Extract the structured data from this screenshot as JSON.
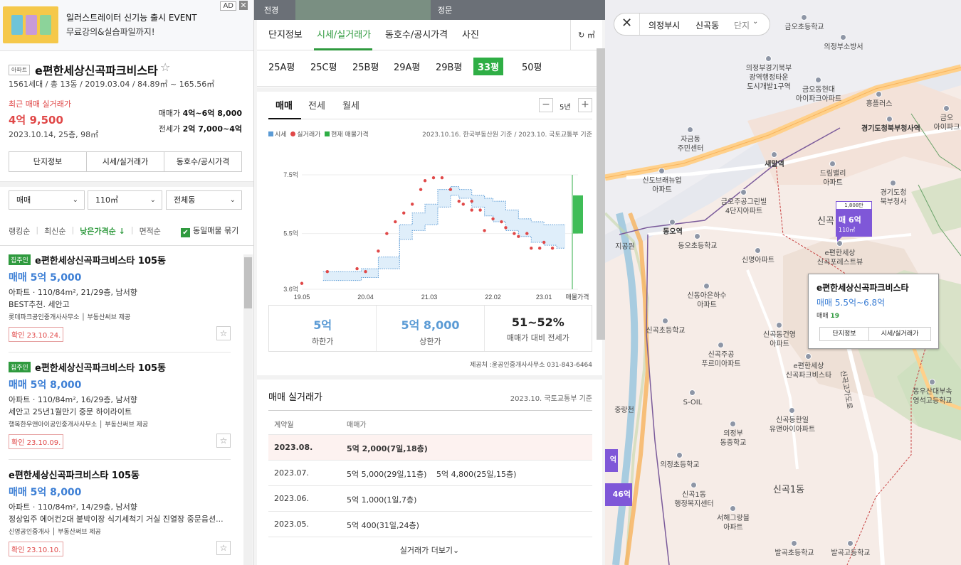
{
  "ad": {
    "title": "일러스트레이터 신기능 출시 EVENT",
    "sub": "무료강의&실습파일까지!",
    "tag": "AD",
    "close": "✕"
  },
  "complex": {
    "type_tag": "아파트",
    "name": "e편한세상신곡파크비스타",
    "star": "☆",
    "meta": "1561세대 / 총 13동 / 2019.03.04 / 84.89㎡ ~ 165.56㎡",
    "recent_label": "최근 매매 실거래가",
    "recent_price": "4억 9,500",
    "recent_detail": "2023.10.14, 25층, 98㎡",
    "sale_label": "매매가",
    "sale_range": "4억~6억 8,000",
    "jeonse_label": "전세가",
    "jeonse_range": "2억 7,000~4억",
    "buttons": [
      "단지정보",
      "시세/실거래가",
      "동호수/공시가격"
    ]
  },
  "filters": {
    "type": "매매",
    "area": "110㎡",
    "dong": "전체동",
    "caret": "⌄"
  },
  "sorts": {
    "items": [
      "랭킹순",
      "최신순",
      "낮은가격순 ↓",
      "면적순"
    ],
    "bar": "|",
    "check_label": "동일매물 묶기",
    "check_mark": "✔"
  },
  "listings": [
    {
      "badge": "집주인",
      "name": "e편한세상신곡파크비스타 105동",
      "price": "매매 5억 5,000",
      "spec": "아파트 · 110/84m², 21/29층, 남서향",
      "desc": "BEST추천. 세안고",
      "agent": "롯데파크공인중개사사무소 │ 부동산써브 제공",
      "confirm": "확인 23.10.24.",
      "fav": "☆"
    },
    {
      "badge": "집주인",
      "name": "e편한세상신곡파크비스타 105동",
      "price": "매매 5억 8,000",
      "spec": "아파트 · 110/84m², 16/29층, 남서향",
      "desc": "세안고 25년1월만기 중문 하이라이트",
      "agent": "행복한우앤아이공인중개사사무소 │ 부동산써브 제공",
      "confirm": "확인 23.10.09.",
      "fav": "☆"
    },
    {
      "badge": "",
      "name": "e편한세상신곡파크비스타 105동",
      "price": "매매 5억 8,000",
      "spec": "아파트 · 110/84m², 14/29층, 남서향",
      "desc": "정상입주 에어컨2대 붙박이장 식기세척기 거실 진열장 중문음션...",
      "agent": "신영공인중개사 │ 부동산써브 제공",
      "confirm": "확인 23.10.10.",
      "fav": "☆"
    }
  ],
  "street": {
    "left": "전경",
    "right": "정문"
  },
  "main_tabs": {
    "items": [
      "단지정보",
      "시세/실거래가",
      "동호수/공시가격",
      "사진"
    ],
    "unit": "↻ ㎡"
  },
  "pyeong_tabs": [
    "25A평",
    "25C평",
    "25B평",
    "29A평",
    "29B평",
    "33평",
    "50평"
  ],
  "deal_tabs": [
    "매매",
    "전세",
    "월세"
  ],
  "period": {
    "minus": "−",
    "plus": "+",
    "value": "5년"
  },
  "legend": {
    "items": [
      "시세",
      "실거래가",
      "현재 매물가격"
    ],
    "colors": [
      "#5b9bd5",
      "#e04848",
      "#2fae45"
    ],
    "source": "2023.10.16. 한국부동산원 기준 / 2023.10. 국토교통부 기준"
  },
  "chart_data": {
    "type": "line",
    "x_ticks": [
      "19.05",
      "20.04",
      "21.03",
      "22.02",
      "23.01",
      "매물가격"
    ],
    "y_ticks": [
      "7.5억",
      "5.5억",
      "3.6억"
    ],
    "ylim": [
      3.6,
      7.5
    ],
    "band_time": [
      0,
      4,
      6,
      9,
      13,
      18,
      21,
      24,
      27,
      30,
      32,
      35,
      38,
      40,
      43,
      46,
      49,
      52,
      55,
      57
    ],
    "band_upper": [
      4.2,
      4.2,
      4.2,
      4.3,
      4.7,
      5.8,
      6.2,
      6.5,
      7.0,
      7.1,
      7.0,
      6.8,
      6.7,
      6.6,
      6.3,
      6.0,
      5.9,
      5.8,
      5.8,
      5.8
    ],
    "band_lower": [
      3.9,
      3.9,
      3.9,
      4.0,
      4.3,
      5.3,
      5.6,
      5.8,
      6.4,
      6.8,
      6.7,
      6.4,
      6.1,
      5.9,
      5.6,
      5.4,
      5.2,
      5.1,
      5.0,
      5.0
    ],
    "trades": [
      [
        -5,
        3.8
      ],
      [
        1,
        4.2
      ],
      [
        8,
        4.3
      ],
      [
        10,
        4.2
      ],
      [
        13,
        4.9
      ],
      [
        15,
        5.5
      ],
      [
        17,
        5.9
      ],
      [
        19,
        6.2
      ],
      [
        21,
        6.5
      ],
      [
        23,
        7.0
      ],
      [
        24,
        7.3
      ],
      [
        26,
        7.4
      ],
      [
        28,
        7.4
      ],
      [
        30,
        7.0
      ],
      [
        32,
        6.6
      ],
      [
        33,
        6.5
      ],
      [
        35,
        6.6
      ],
      [
        35,
        6.3
      ],
      [
        37,
        6.3
      ],
      [
        38,
        5.6
      ],
      [
        40,
        6.0
      ],
      [
        42,
        5.9
      ],
      [
        43,
        5.7
      ],
      [
        45,
        5.5
      ],
      [
        46,
        5.4
      ],
      [
        48,
        5.5
      ],
      [
        49,
        5.0
      ],
      [
        51,
        5.0
      ],
      [
        52,
        5.2
      ],
      [
        54,
        5.0
      ]
    ],
    "listing_range": [
      5.5,
      6.8
    ]
  },
  "stats": [
    {
      "value": "5억",
      "label": "하한가",
      "color": "#5b9bd5"
    },
    {
      "value": "5억 8,000",
      "label": "상한가",
      "color": "#5b9bd5"
    },
    {
      "value": "51~52%",
      "label": "매매가 대비 전세가",
      "color": "#111111"
    }
  ],
  "provider": "제공처 :윤공인중개사사무소 031-843-6464",
  "trades": {
    "title": "매매 실거래가",
    "note": "2023.10. 국토교통부 기준",
    "headers": [
      "계약월",
      "매매가"
    ],
    "rows": [
      {
        "month": "2023.08.",
        "p1": "5억 2,000(7일,18층)",
        "p2": ""
      },
      {
        "month": "2023.07.",
        "p1": "5억 5,000(29일,11층)",
        "p2": "5억 4,800(25일,15층)"
      },
      {
        "month": "2023.06.",
        "p1": "5억 1,000(1일,7층)",
        "p2": ""
      },
      {
        "month": "2023.05.",
        "p1": "5억 400(31일,24층)",
        "p2": ""
      }
    ],
    "more": "실거래가 더보기⌄"
  },
  "map": {
    "close": "✕",
    "region": [
      "의정부시",
      "신곡동",
      "단지"
    ],
    "chev": "⌄",
    "labels": [
      "금오초등학교",
      "의정부소방서",
      "의정부경기북부\n광역행정타운\n도시개발1구역",
      "흥플러스",
      "금오동현대\n아이파크아파트",
      "금오\n아이파크",
      "경기도청북부청사역",
      "자금동\n주민센터",
      "새말역",
      "신도브래뉴업\n아파트",
      "드림밸리\n아파트",
      "경기도청\n북부청사",
      "금오주공그린빌\n4단지아파트",
      "동오역",
      "동오초등학교",
      "신곡",
      "e편한세상\n신곡포레스트뷰",
      "신명아파트",
      "신동아은하수\n아파트",
      "신곡동건영\n아파트",
      "신곡초등학교",
      "신곡주공\n푸르미아파트",
      "e편한세상\n신곡파크비스타",
      "S-OIL",
      "신곡동한일\n유앤아이아파트",
      "동우산대부속\n영석고등학교",
      "의정부\n동중학교",
      "의정초등학교",
      "신곡1동\n행정복지센터",
      "서해그랑블\n아파트",
      "신곡1동",
      "발곡초등학교",
      "발곡고등학교",
      "지공원",
      "중랑천"
    ],
    "marker": {
      "top": "1,808만",
      "label": "매 6억",
      "area": "110㎡"
    },
    "popup": {
      "name": "e편한세상신곡파크비스타",
      "price": "매매 5.5억~6.8억",
      "count_label": "매매",
      "count": "19",
      "btn1": "단지정보",
      "btn2": "시세/실거래가"
    },
    "side_markers": [
      "억",
      "46억"
    ],
    "road_label": "신곡고가도로"
  }
}
